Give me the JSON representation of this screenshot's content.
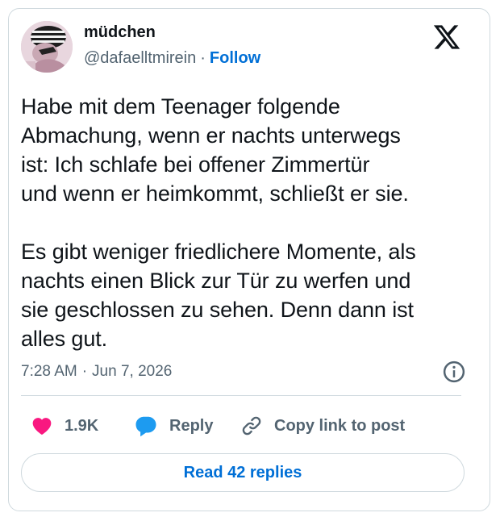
{
  "author": {
    "name": "müdchen",
    "handle": "@dafaelltmirein",
    "separator": "·",
    "follow_label": "Follow"
  },
  "tweet": {
    "text": "Habe mit dem Teenager folgende\nAbmachung, wenn er nachts unterwegs\nist: Ich schlafe bei offener Zimmertür\nund wenn er heimkommt, schließt er sie.\n\nEs gibt weniger friedlichere Momente, als\nnachts einen Blick zur Tür zu werfen und\nsie geschlossen zu sehen. Denn dann ist\nalles gut.",
    "time": "7:28 AM",
    "date_separator": "·",
    "date": "Jun 7, 2026"
  },
  "actions": {
    "like_count": "1.9K",
    "reply_label": "Reply",
    "copy_label": "Copy link to post"
  },
  "read_replies_label": "Read 42 replies",
  "icons": {
    "brand": "x-logo-icon",
    "info": "info-icon",
    "like": "heart-icon",
    "reply": "reply-bubble-icon",
    "copy": "link-icon"
  },
  "colors": {
    "accent": "#006fd6",
    "like": "#f91880",
    "reply": "#1d9bf0",
    "muted": "#536471",
    "border": "#cfd9de"
  }
}
